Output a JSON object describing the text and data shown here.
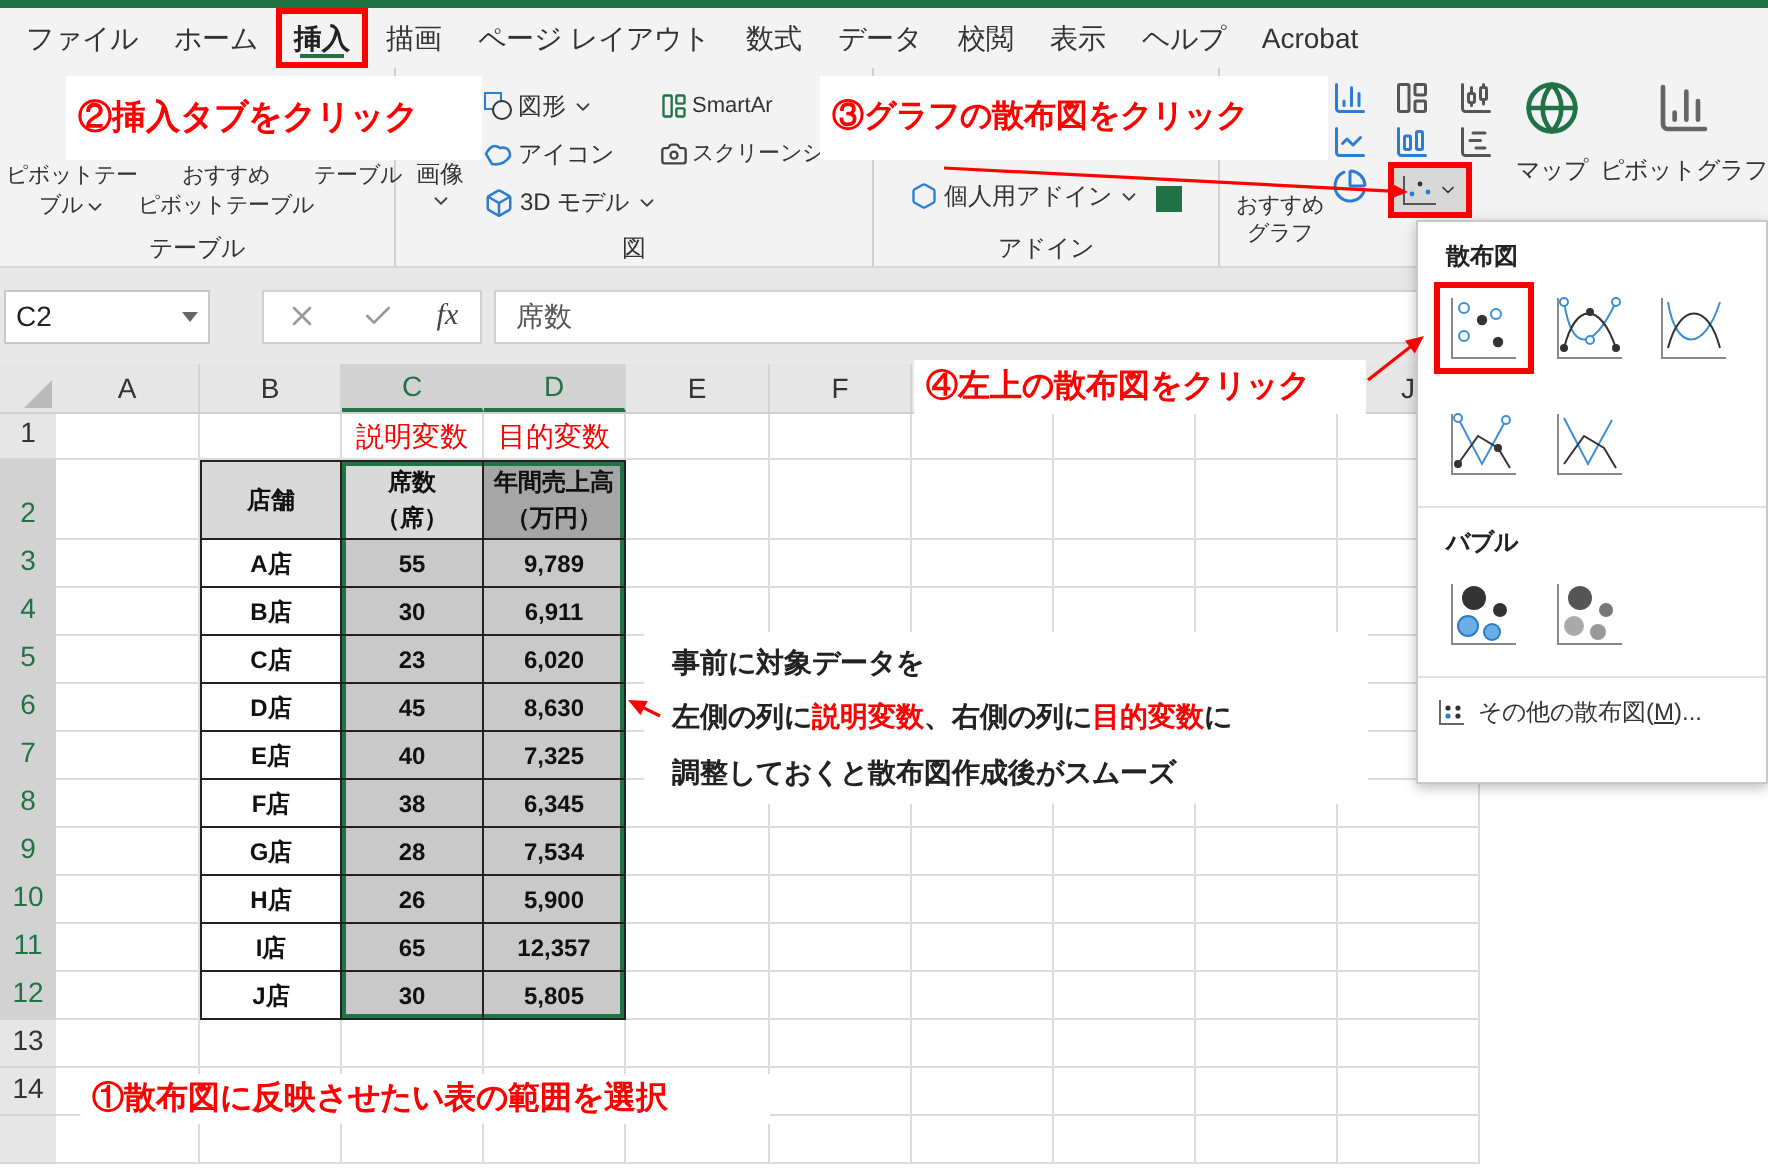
{
  "tabs": [
    {
      "label": "ファイル",
      "selected": false,
      "highlighted": false
    },
    {
      "label": "ホーム",
      "selected": false,
      "highlighted": false
    },
    {
      "label": "挿入",
      "selected": true,
      "highlighted": true
    },
    {
      "label": "描画",
      "selected": false,
      "highlighted": false
    },
    {
      "label": "ページ レイアウト",
      "selected": false,
      "highlighted": false
    },
    {
      "label": "数式",
      "selected": false,
      "highlighted": false
    },
    {
      "label": "データ",
      "selected": false,
      "highlighted": false
    },
    {
      "label": "校閲",
      "selected": false,
      "highlighted": false
    },
    {
      "label": "表示",
      "selected": false,
      "highlighted": false
    },
    {
      "label": "ヘルプ",
      "selected": false,
      "highlighted": false
    },
    {
      "label": "Acrobat",
      "selected": false,
      "highlighted": false
    }
  ],
  "ribbon": {
    "table_group": {
      "label": "テーブル",
      "buttons": [
        {
          "lines": [
            "ピボットテー",
            "ブル"
          ],
          "dropdown": true
        },
        {
          "lines": [
            "おすすめ",
            "ピボットテーブル"
          ],
          "dropdown": false
        },
        {
          "lines": [
            "テーブル"
          ],
          "dropdown": false
        }
      ]
    },
    "illustrations_group": {
      "label": "図",
      "image_button": {
        "lines": [
          "画像"
        ],
        "dropdown": true
      },
      "small_buttons": [
        {
          "label": "図形",
          "dropdown": true
        },
        {
          "label": "アイコン",
          "dropdown": false
        },
        {
          "label": "3D モデル",
          "dropdown": true
        }
      ],
      "smart_buttons": [
        {
          "label": "SmartAr"
        },
        {
          "label": "スクリーンシ"
        }
      ]
    },
    "addins_group": {
      "label": "アドイン",
      "button": {
        "label": "個人用アドイン",
        "dropdown": true
      }
    },
    "charts_group": {
      "recommended": {
        "lines": [
          "おすすめ",
          "グラフ"
        ]
      },
      "scatter_button": {
        "highlighted": true
      },
      "map": {
        "label": "マップ"
      },
      "pivot_chart": {
        "label": "ピボットグラフ"
      }
    }
  },
  "formula_bar": {
    "name_box": "C2",
    "function_label": "fx",
    "value": "席数"
  },
  "sheet": {
    "columns": [
      {
        "label": "A",
        "selected": false
      },
      {
        "label": "B",
        "selected": false
      },
      {
        "label": "C",
        "selected": true
      },
      {
        "label": "D",
        "selected": true
      },
      {
        "label": "E",
        "selected": false
      },
      {
        "label": "F",
        "selected": false
      },
      {
        "label": "J",
        "selected": false
      }
    ],
    "rows": [
      {
        "number": "1",
        "selected": false,
        "kind": "labels",
        "cells": [
          null,
          null,
          [
            "説明変数"
          ],
          [
            "目的変数"
          ]
        ]
      },
      {
        "number": "2",
        "selected": true,
        "kind": "header",
        "cells": [
          null,
          [
            "店舗"
          ],
          [
            "席数",
            "（席）"
          ],
          [
            "年間売上高",
            "（万円）"
          ]
        ]
      },
      {
        "number": "3",
        "selected": true,
        "kind": "data",
        "cells": [
          null,
          [
            "A店"
          ],
          [
            "55"
          ],
          [
            "9,789"
          ]
        ]
      },
      {
        "number": "4",
        "selected": true,
        "kind": "data",
        "cells": [
          null,
          [
            "B店"
          ],
          [
            "30"
          ],
          [
            "6,911"
          ]
        ]
      },
      {
        "number": "5",
        "selected": true,
        "kind": "data",
        "cells": [
          null,
          [
            "C店"
          ],
          [
            "23"
          ],
          [
            "6,020"
          ]
        ]
      },
      {
        "number": "6",
        "selected": true,
        "kind": "data",
        "cells": [
          null,
          [
            "D店"
          ],
          [
            "45"
          ],
          [
            "8,630"
          ]
        ]
      },
      {
        "number": "7",
        "selected": true,
        "kind": "data",
        "cells": [
          null,
          [
            "E店"
          ],
          [
            "40"
          ],
          [
            "7,325"
          ]
        ]
      },
      {
        "number": "8",
        "selected": true,
        "kind": "data",
        "cells": [
          null,
          [
            "F店"
          ],
          [
            "38"
          ],
          [
            "6,345"
          ]
        ]
      },
      {
        "number": "9",
        "selected": true,
        "kind": "data",
        "cells": [
          null,
          [
            "G店"
          ],
          [
            "28"
          ],
          [
            "7,534"
          ]
        ]
      },
      {
        "number": "10",
        "selected": true,
        "kind": "data",
        "cells": [
          null,
          [
            "H店"
          ],
          [
            "26"
          ],
          [
            "5,900"
          ]
        ]
      },
      {
        "number": "11",
        "selected": true,
        "kind": "data",
        "cells": [
          null,
          [
            "I店"
          ],
          [
            "65"
          ],
          [
            "12,357"
          ]
        ]
      },
      {
        "number": "12",
        "selected": true,
        "kind": "data",
        "cells": [
          null,
          [
            "J店"
          ],
          [
            "30"
          ],
          [
            "5,805"
          ]
        ]
      },
      {
        "number": "13",
        "selected": false,
        "kind": "empty"
      },
      {
        "number": "14",
        "selected": false,
        "kind": "empty"
      },
      {
        "selected": false,
        "kind": "empty"
      }
    ]
  },
  "callouts": [
    {
      "text": "②挿入タブをクリック"
    },
    {
      "text": "③グラフの散布図をクリック"
    },
    {
      "text": "④左上の散布図をクリック"
    },
    {
      "text": "①散布図に反映させたい表の範囲を選択"
    }
  ],
  "note": {
    "lines": [
      [
        {
          "text": "事前に対象データを",
          "highlight": false
        }
      ],
      [
        {
          "text": "左側の列に",
          "highlight": false
        },
        {
          "text": "説明変数",
          "highlight": true
        },
        {
          "text": "、右側の列に",
          "highlight": false
        },
        {
          "text": "目的変数",
          "highlight": true
        },
        {
          "text": "に",
          "highlight": false
        }
      ],
      [
        {
          "text": "調整しておくと散布図作成後がスムーズ",
          "highlight": false
        }
      ]
    ]
  },
  "scatter_menu": {
    "sections": [
      {
        "title": "散布図",
        "items": [
          {
            "kind": "markers",
            "highlighted": true
          },
          {
            "kind": "smooth-markers",
            "highlighted": false
          },
          {
            "kind": "smooth",
            "highlighted": false
          },
          {
            "kind": "straight-markers",
            "highlighted": false
          },
          {
            "kind": "straight",
            "highlighted": false
          }
        ]
      },
      {
        "title": "バブル",
        "items": [
          {
            "kind": "bubble",
            "highlighted": false
          },
          {
            "kind": "bubble-3d",
            "highlighted": false
          }
        ]
      }
    ],
    "more": {
      "before": "その他の散布図(",
      "accesskey": "M",
      "after": ")..."
    }
  }
}
